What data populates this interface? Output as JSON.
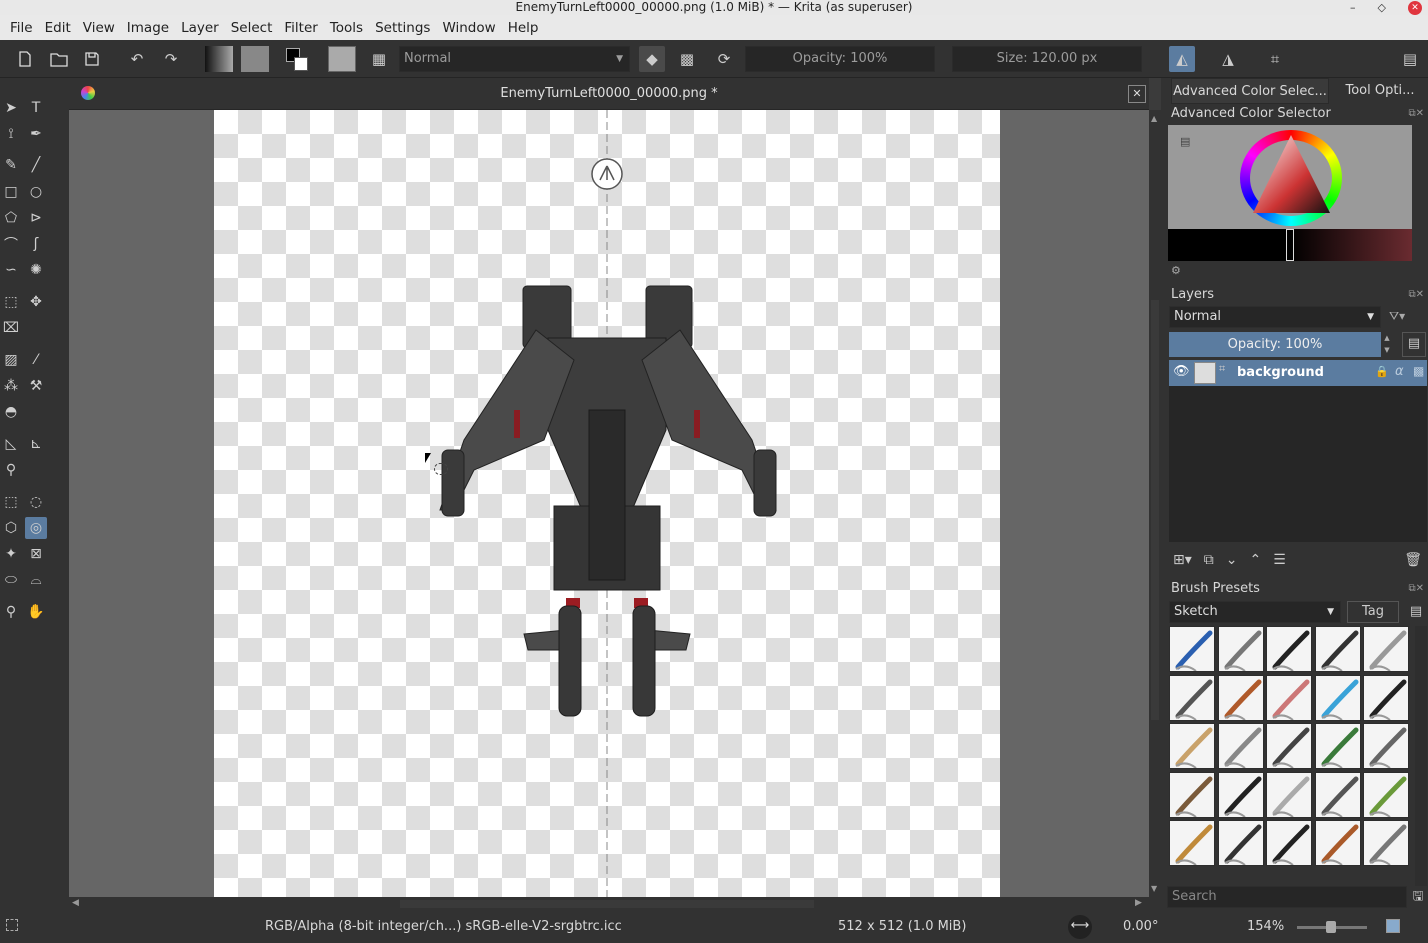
{
  "window": {
    "title": "EnemyTurnLeft0000_00000.png (1.0 MiB)  * — Krita (as superuser)"
  },
  "menu": [
    "File",
    "Edit",
    "View",
    "Image",
    "Layer",
    "Select",
    "Filter",
    "Tools",
    "Settings",
    "Window",
    "Help"
  ],
  "toolbar": {
    "blend_mode": "Normal",
    "opacity": "Opacity: 100%",
    "size": "Size: 120.00 px"
  },
  "document": {
    "tab_title": "EnemyTurnLeft0000_00000.png *"
  },
  "dock_tabs": [
    "Advanced Color Selec...",
    "Tool Opti..."
  ],
  "color_selector": {
    "title": "Advanced Color Selector"
  },
  "layers": {
    "title": "Layers",
    "blend_mode": "Normal",
    "opacity": "Opacity:  100%",
    "items": [
      {
        "name": "background"
      }
    ]
  },
  "brush_presets": {
    "title": "Brush Presets",
    "tag_filter": "Sketch",
    "tag_button": "Tag",
    "search_placeholder": "Search"
  },
  "status": {
    "color_space": "RGB/Alpha (8-bit integer/ch...)  sRGB-elle-V2-srgbtrc.icc",
    "image_size": "512 x 512 (1.0 MiB)",
    "rotation": "0.00°",
    "zoom": "154%"
  },
  "colors": {
    "accent": "#5b7ca0",
    "panel": "#323232",
    "canvas_bg": "#666666"
  }
}
